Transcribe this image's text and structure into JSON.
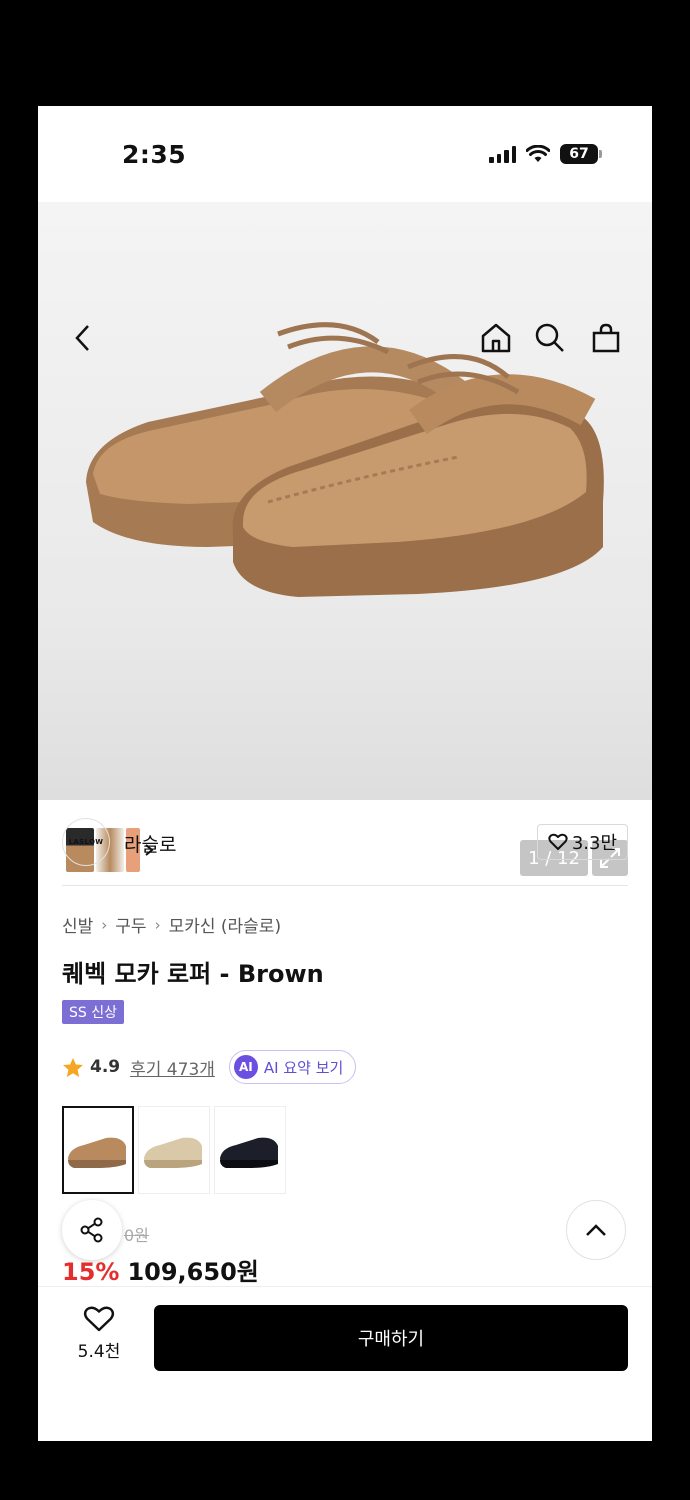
{
  "status_bar": {
    "time": "2:35",
    "battery": "67"
  },
  "gallery": {
    "counter": "1 / 12"
  },
  "brand": {
    "logo_text": "LASLOW",
    "name": "라슬로",
    "likes": "3.3만"
  },
  "breadcrumb": [
    "신발",
    "구두",
    "모카신 (라슬로)"
  ],
  "product": {
    "title": "퀘벡 모카 로퍼 - Brown",
    "badge": "SS 신상",
    "rating": "4.9",
    "reviews": "후기 473개",
    "ai_icon": "AI",
    "ai_label": "AI 요약 보기",
    "original_price": "0원",
    "discount": "15%",
    "price": "109,650원"
  },
  "variants": [
    {
      "name": "brown",
      "color": "#b88a5e"
    },
    {
      "name": "beige",
      "color": "#d9c9a8"
    },
    {
      "name": "black",
      "color": "#1c1f2a"
    }
  ],
  "bottom": {
    "wish_count": "5.4천",
    "buy_label": "구매하기"
  },
  "icons": [
    "back-icon",
    "home-icon",
    "search-icon",
    "bag-icon",
    "expand-icon",
    "heart-icon",
    "share-icon",
    "chevron-up-icon",
    "star-icon"
  ],
  "colors": {
    "accent_purple": "#7b6fd6",
    "discount_red": "#e62d2d",
    "shoe_suede": "#b88a5e"
  }
}
